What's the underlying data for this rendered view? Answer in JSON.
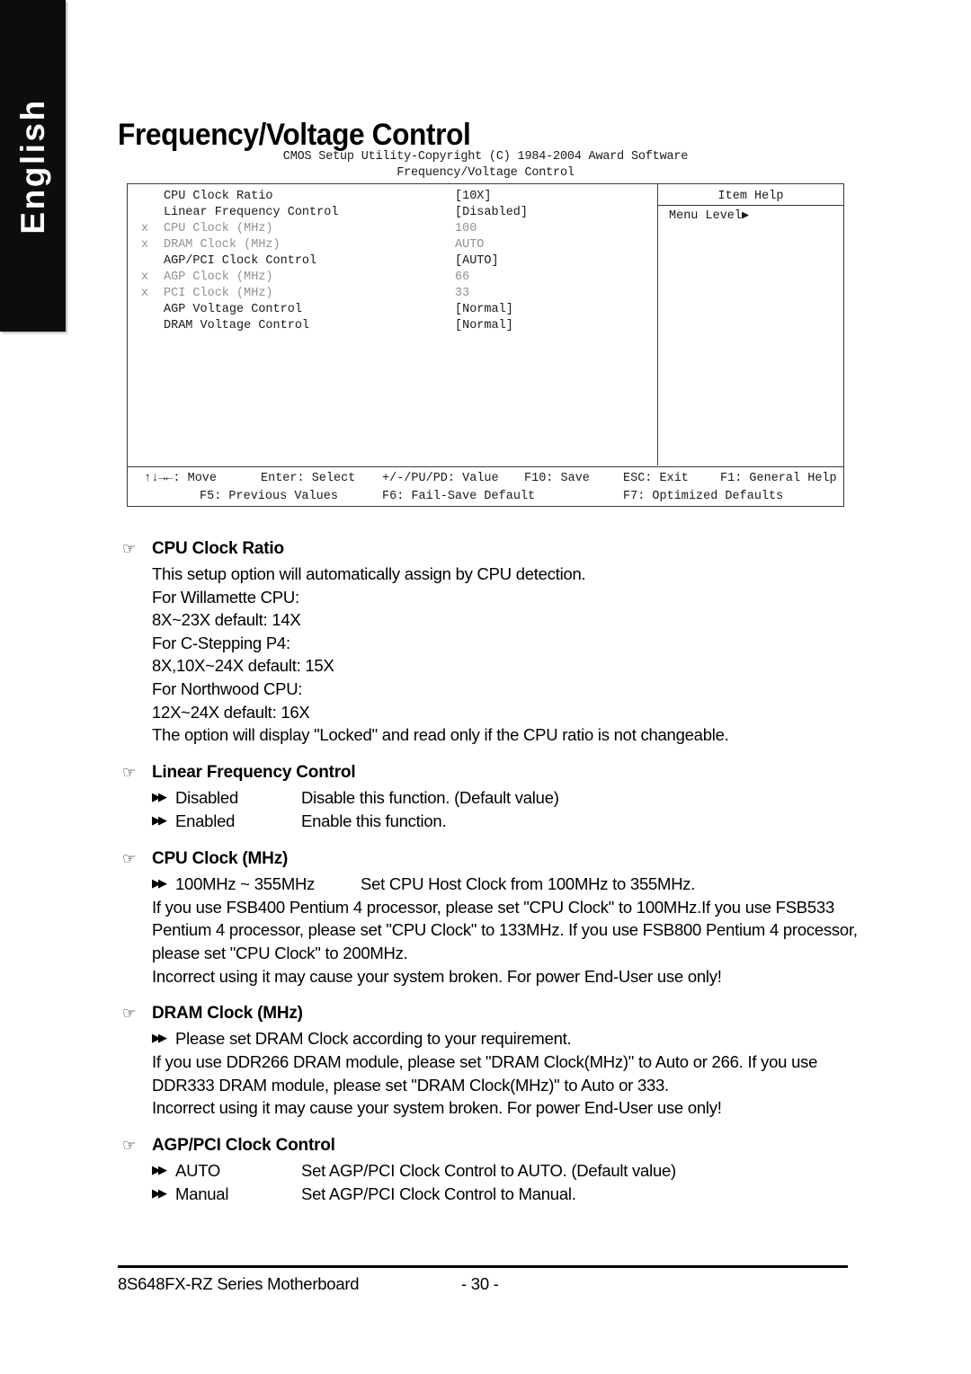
{
  "sidebar": {
    "language_tab": "English"
  },
  "page": {
    "title": "Frequency/Voltage Control",
    "footer_doc": "8S648FX-RZ Series Motherboard",
    "footer_page": "- 30 -"
  },
  "bios": {
    "caption_line1": "CMOS Setup Utility-Copyright (C) 1984-2004 Award Software",
    "caption_line2": "Frequency/Voltage Control",
    "rows": [
      {
        "mark": "",
        "label": "CPU Clock Ratio",
        "value": "[10X]",
        "dim": false
      },
      {
        "mark": "",
        "label": "Linear Frequency Control",
        "value": "[Disabled]",
        "dim": false
      },
      {
        "mark": "x",
        "label": "CPU Clock (MHz)",
        "value": "100",
        "dim": true
      },
      {
        "mark": "x",
        "label": "DRAM Clock (MHz)",
        "value": "AUTO",
        "dim": true
      },
      {
        "mark": "",
        "label": "AGP/PCI Clock Control",
        "value": "[AUTO]",
        "dim": false
      },
      {
        "mark": "x",
        "label": "AGP Clock (MHz)",
        "value": "66",
        "dim": true
      },
      {
        "mark": "x",
        "label": "PCI Clock (MHz)",
        "value": "33",
        "dim": true
      },
      {
        "mark": "",
        "label": "AGP Voltage Control",
        "value": "[Normal]",
        "dim": false
      },
      {
        "mark": "",
        "label": "DRAM Voltage Control",
        "value": "[Normal]",
        "dim": false
      }
    ],
    "help_title": "Item Help",
    "help_text": "Menu Level▶",
    "footer": {
      "line1": [
        "↑↓→←: Move",
        "Enter: Select",
        "+/-/PU/PD: Value",
        "F10: Save",
        "ESC: Exit",
        "F1: General Help"
      ],
      "line2": [
        "F5: Previous Values",
        "F6: Fail-Save Default",
        "F7: Optimized Defaults"
      ]
    }
  },
  "sections": {
    "cpu_clock_ratio": {
      "heading": "CPU Clock Ratio",
      "lines": [
        "This setup option will automatically assign by CPU detection.",
        "For Willamette CPU:",
        "8X~23X default: 14X",
        "For C-Stepping P4:",
        "8X,10X~24X default: 15X",
        "For Northwood CPU:",
        "12X~24X default: 16X",
        "The option will display \"Locked\" and read only if the CPU ratio is not changeable."
      ]
    },
    "linear_frequency_control": {
      "heading": "Linear Frequency Control",
      "options": [
        {
          "name": "Disabled",
          "desc": "Disable this function. (Default value)"
        },
        {
          "name": "Enabled",
          "desc": "Enable this function."
        }
      ]
    },
    "cpu_clock_mhz": {
      "heading": "CPU Clock (MHz)",
      "options": [
        {
          "name": "100MHz ~ 355MHz",
          "desc": "Set CPU Host Clock from 100MHz to 355MHz."
        }
      ],
      "paragraph": "If you use FSB400 Pentium 4 processor, please set \"CPU Clock\" to 100MHz.If you use FSB533 Pentium 4 processor, please set \"CPU Clock\" to 133MHz. If you use FSB800 Pentium 4 processor, please set \"CPU Clock\" to 200MHz.",
      "warning": "Incorrect using it may cause your system broken. For power End-User use only!"
    },
    "dram_clock_mhz": {
      "heading": "DRAM Clock (MHz)",
      "options": [
        {
          "name": "Please set DRAM Clock according to your requirement.",
          "desc": ""
        }
      ],
      "paragraph": "If you use DDR266 DRAM module, please set \"DRAM Clock(MHz)\" to Auto or 266. If you use DDR333 DRAM module, please set \"DRAM Clock(MHz)\" to Auto or 333.",
      "warning": "Incorrect using it may cause your system broken. For power End-User use only!"
    },
    "agp_pci_clock_control": {
      "heading": "AGP/PCI Clock Control",
      "options": [
        {
          "name": "AUTO",
          "desc": "Set AGP/PCI Clock Control to AUTO. (Default value)"
        },
        {
          "name": "Manual",
          "desc": "Set AGP/PCI Clock Control to Manual."
        }
      ]
    }
  },
  "icons": {
    "hand": "☞",
    "double_arrow": "▶▶"
  }
}
